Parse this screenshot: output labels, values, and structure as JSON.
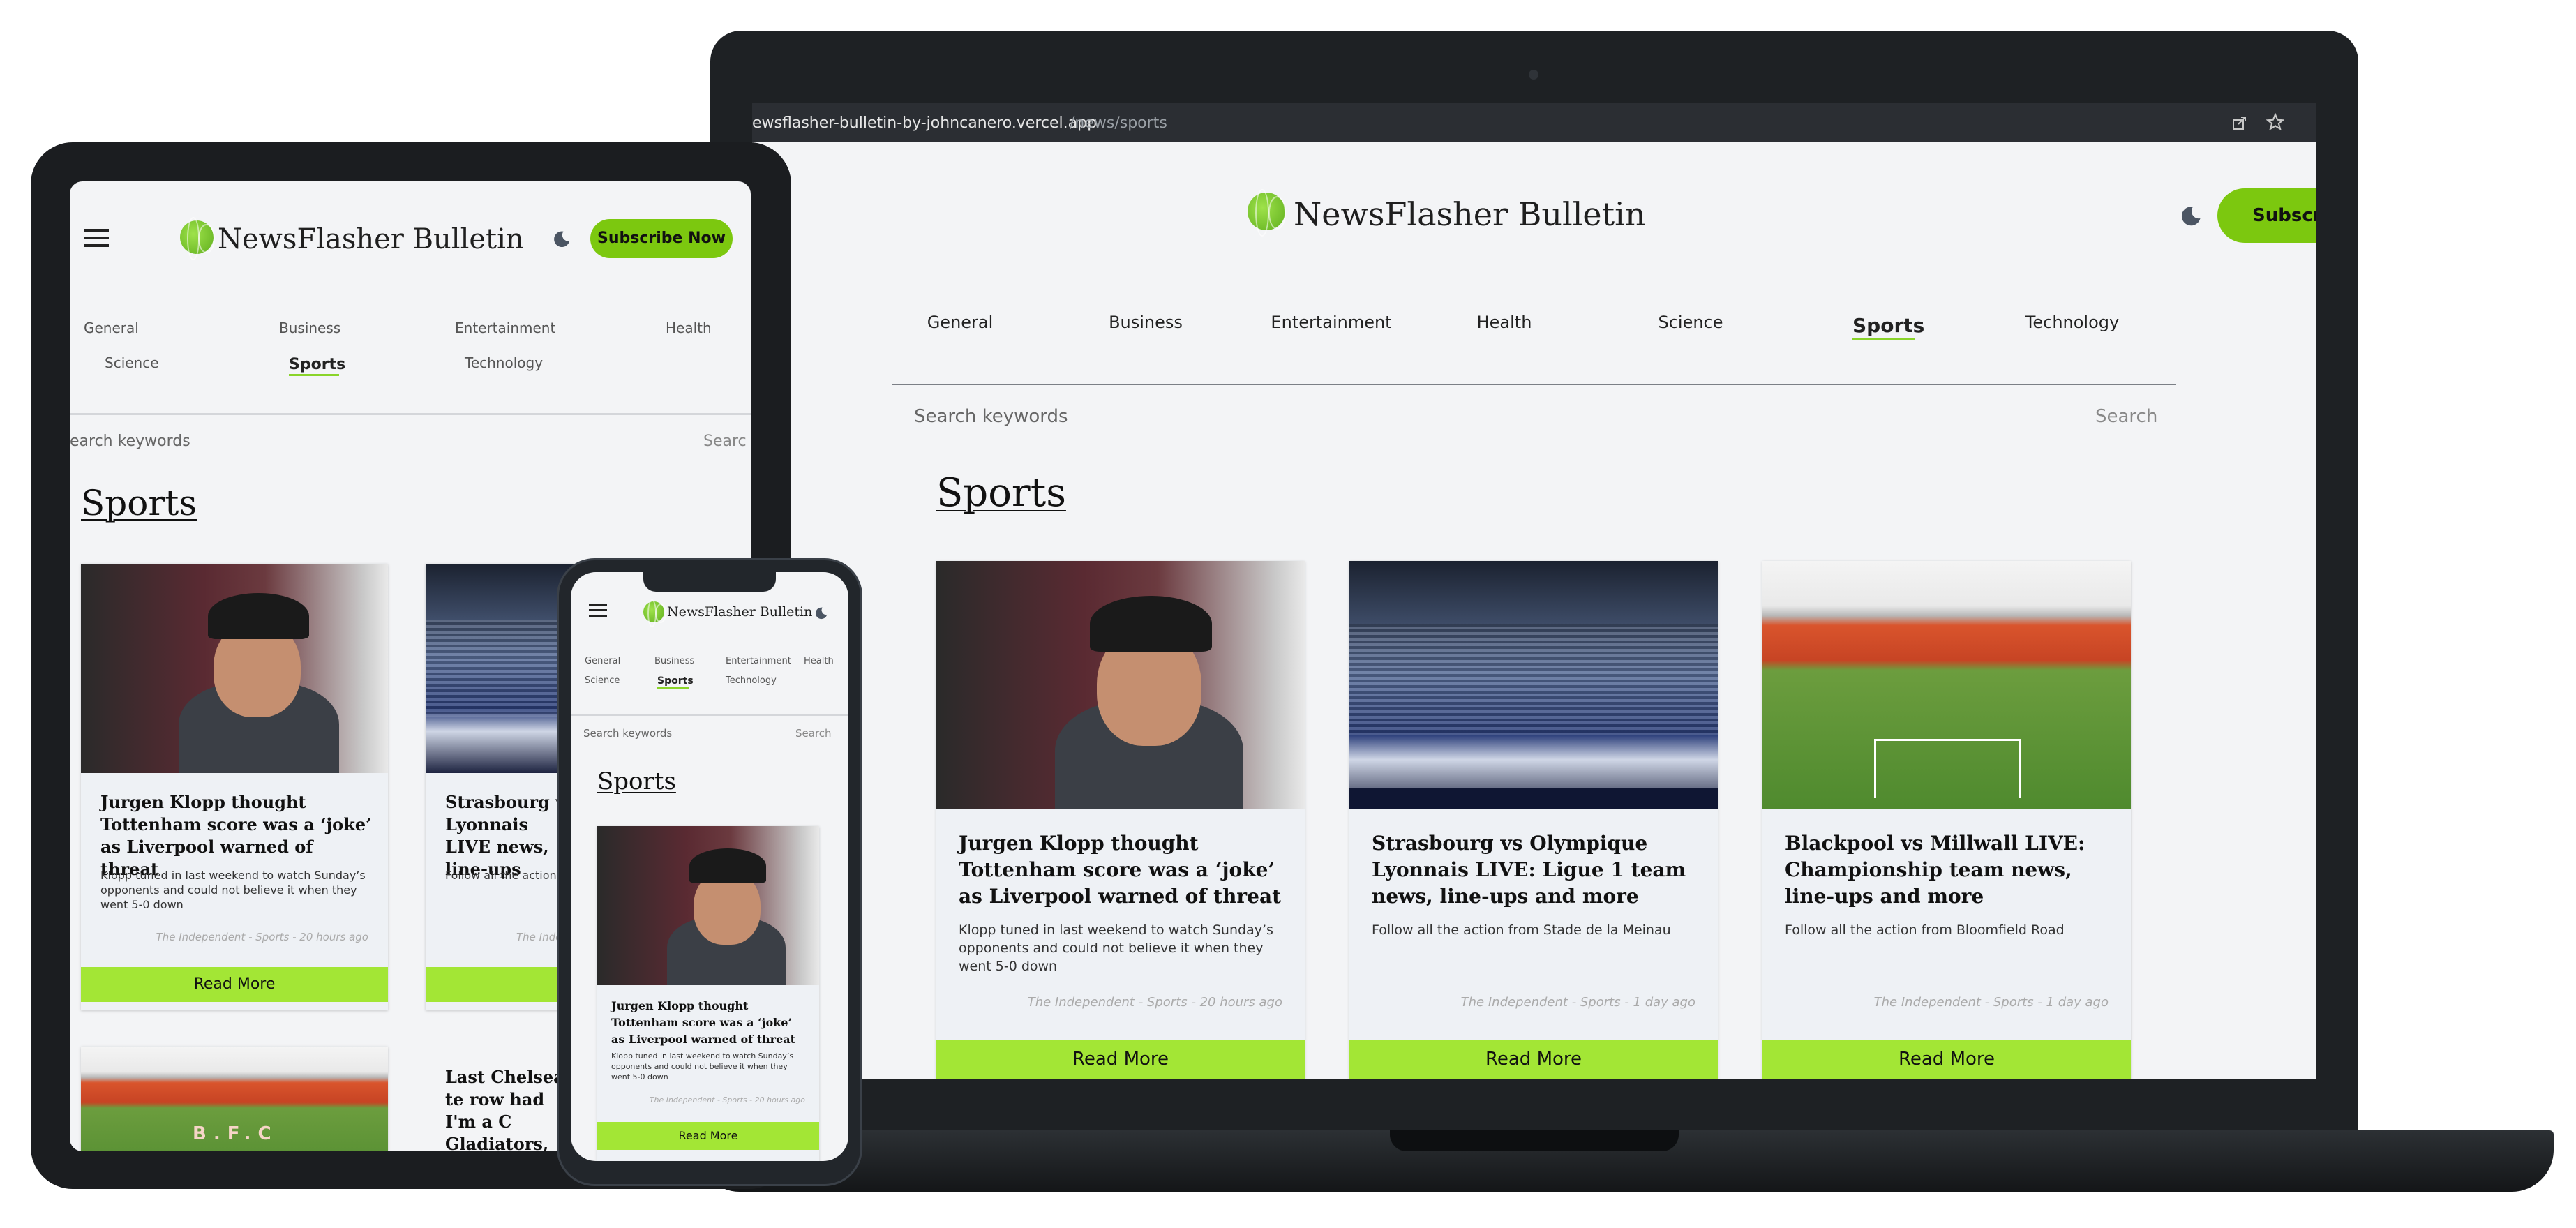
{
  "site": {
    "brand": "NewsFlasher Bulletin",
    "subscribe_label": "Subscribe Now",
    "subscribe_label_cut": "Subscri",
    "categories": [
      "General",
      "Business",
      "Entertainment",
      "Health",
      "Science",
      "Sports",
      "Technology"
    ],
    "active_category": "Sports",
    "search_placeholder": "Search keywords",
    "search_placeholder_tablet": "earch keywords",
    "search_button": "Search",
    "search_button_cut": "Searc",
    "section_title": "Sports",
    "read_more": "Read More",
    "accent_color": "#a3e635",
    "subscribe_color": "#7cc80f"
  },
  "browser": {
    "url_host": "newsflasher-bulletin-by-johncanero.vercel.app",
    "url_host_visible": "ewsflasher-bulletin-by-johncanero.vercel.app",
    "url_path": "/news/sports",
    "share_icon": "share-icon",
    "bookmark_icon": "star-icon"
  },
  "articles": [
    {
      "title": "Jurgen Klopp thought Tottenham score was a ‘joke’ as Liverpool warned of threat",
      "desc": "Klopp tuned in last weekend to watch Sunday’s opponents and could not believe it when they went 5-0 down",
      "meta": "The Independent - Sports - 20 hours ago"
    },
    {
      "title": "Strasbourg vs Olympique Lyonnais LIVE: Ligue 1 team news, line-ups and more",
      "desc": "Follow all the action from Stade de la Meinau",
      "meta": "The Independent - Sports - 1 day ago"
    },
    {
      "title": "Blackpool vs Millwall LIVE: Championship team news, line-ups and more",
      "desc": "Follow all the action from Bloomfield Road",
      "meta": "The Independent - Sports - 1 day ago"
    }
  ],
  "tablet_partial": {
    "card2_title": "Strasbourg vs Lyonnais LIVE news, line-ups",
    "card2_desc": "Follow all the action",
    "card2_meta": "The Inde",
    "card2_btn": "Re",
    "card4_title": "Last Chelsea te row had I'm a C Gladiators, So talkSPORT hos",
    "card3_img_text": "B.F.C"
  }
}
